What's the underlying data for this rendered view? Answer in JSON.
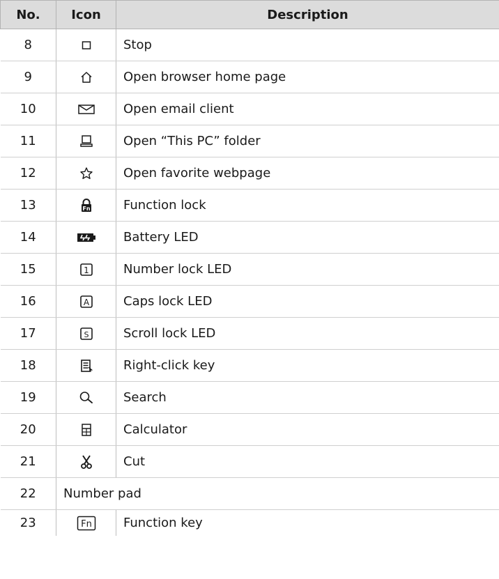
{
  "table": {
    "headers": {
      "no": "No.",
      "icon": "Icon",
      "description": "Description"
    },
    "rows": [
      {
        "no": "8",
        "icon": "stop-icon",
        "description": "Stop"
      },
      {
        "no": "9",
        "icon": "home-icon",
        "description": "Open browser home page"
      },
      {
        "no": "10",
        "icon": "mail-icon",
        "description": "Open email client"
      },
      {
        "no": "11",
        "icon": "computer-icon",
        "description": "Open “This PC” folder"
      },
      {
        "no": "12",
        "icon": "star-icon",
        "description": "Open favorite webpage"
      },
      {
        "no": "13",
        "icon": "function-lock-icon",
        "description": "Function lock",
        "icon_text": "Fn"
      },
      {
        "no": "14",
        "icon": "battery-icon",
        "description": "Battery LED"
      },
      {
        "no": "15",
        "icon": "number-lock-icon",
        "description": "Number lock LED",
        "icon_text": "1"
      },
      {
        "no": "16",
        "icon": "caps-lock-icon",
        "description": "Caps lock LED",
        "icon_text": "A"
      },
      {
        "no": "17",
        "icon": "scroll-lock-icon",
        "description": "Scroll lock LED",
        "icon_text": "S"
      },
      {
        "no": "18",
        "icon": "menu-key-icon",
        "description": "Right-click key"
      },
      {
        "no": "19",
        "icon": "search-icon",
        "description": "Search"
      },
      {
        "no": "20",
        "icon": "calculator-icon",
        "description": "Calculator"
      },
      {
        "no": "21",
        "icon": "scissors-icon",
        "description": "Cut"
      },
      {
        "no": "22",
        "description": "Number pad"
      },
      {
        "no": "23",
        "icon": "fn-key-icon",
        "description": "Function key",
        "icon_text": "Fn"
      }
    ]
  }
}
